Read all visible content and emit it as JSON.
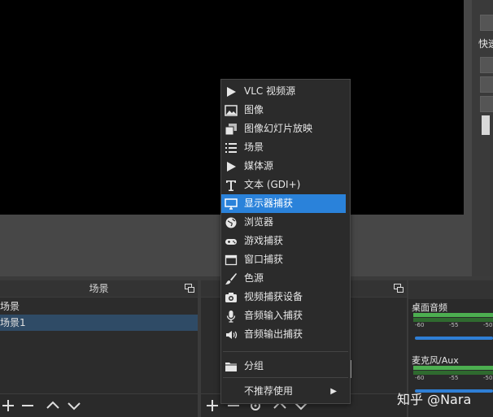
{
  "right_panel": {
    "label": "快速"
  },
  "scenes_dock": {
    "title": "场景",
    "items": [
      {
        "label": "场景",
        "selected": false
      },
      {
        "label": "场景1",
        "selected": true
      }
    ]
  },
  "audio_mixer": {
    "channels": [
      {
        "name": "桌面音频",
        "ticks": [
          "-60",
          "-55",
          "-50"
        ]
      },
      {
        "name": "麦克风/Aux",
        "ticks": [
          "-60",
          "-55",
          "-50"
        ]
      }
    ]
  },
  "context_menu": {
    "items": [
      {
        "label": "VLC 视频源",
        "icon": "play-icon"
      },
      {
        "label": "图像",
        "icon": "image-icon"
      },
      {
        "label": "图像幻灯片放映",
        "icon": "slideshow-icon"
      },
      {
        "label": "场景",
        "icon": "list-icon"
      },
      {
        "label": "媒体源",
        "icon": "play-icon"
      },
      {
        "label": "文本 (GDI+)",
        "icon": "text-icon"
      },
      {
        "label": "显示器捕获",
        "icon": "monitor-icon",
        "highlighted": true
      },
      {
        "label": "浏览器",
        "icon": "globe-icon"
      },
      {
        "label": "游戏捕获",
        "icon": "gamepad-icon"
      },
      {
        "label": "窗口捕获",
        "icon": "window-icon"
      },
      {
        "label": "色源",
        "icon": "brush-icon"
      },
      {
        "label": "视频捕获设备",
        "icon": "camera-icon"
      },
      {
        "label": "音频输入捕获",
        "icon": "microphone-icon"
      },
      {
        "label": "音频输出捕获",
        "icon": "speaker-icon"
      }
    ],
    "group": {
      "label": "分组",
      "icon": "folder-icon"
    },
    "deprecated": {
      "label": "不推荐使用",
      "submenu": true
    }
  },
  "watermark": "知乎 @Nara",
  "colors": {
    "highlight": "#2a82da",
    "meter_green": "#4caf50",
    "slider_blue": "#2f7fd6"
  }
}
